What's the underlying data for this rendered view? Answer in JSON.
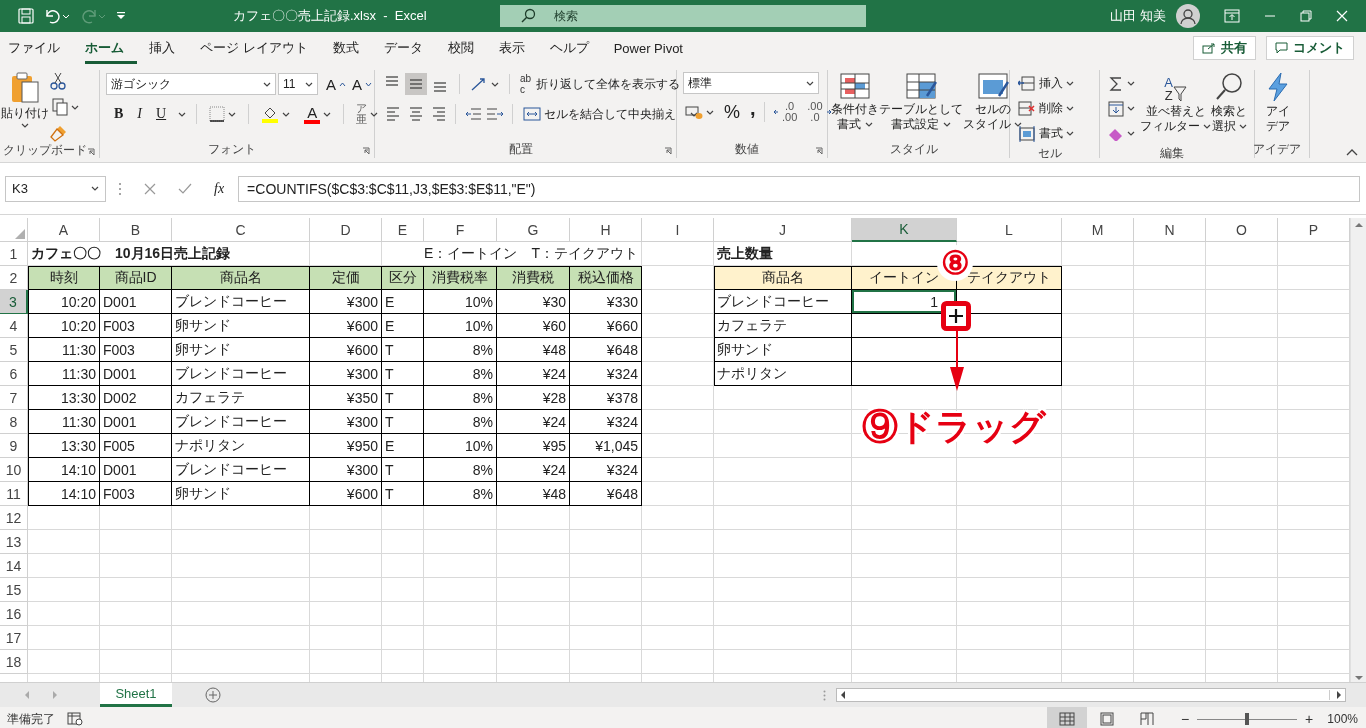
{
  "title_bar": {
    "file_title": "カフェ〇〇売上記録.xlsx  -  Excel",
    "search_placeholder": "検索",
    "user_name": "山田 知美",
    "redo_disabled": true
  },
  "menu_tabs": [
    {
      "label": "ファイル",
      "selected": false
    },
    {
      "label": "ホーム",
      "selected": true
    },
    {
      "label": "挿入",
      "selected": false
    },
    {
      "label": "ページ レイアウト",
      "selected": false
    },
    {
      "label": "数式",
      "selected": false
    },
    {
      "label": "データ",
      "selected": false
    },
    {
      "label": "校閲",
      "selected": false
    },
    {
      "label": "表示",
      "selected": false
    },
    {
      "label": "ヘルプ",
      "selected": false
    },
    {
      "label": "Power Pivot",
      "selected": false
    }
  ],
  "share_button": "共有",
  "comment_button": "コメント",
  "ribbon": {
    "groups": [
      {
        "kind": "clipboard",
        "label": "クリップボード",
        "paste": "貼り付け"
      },
      {
        "kind": "font",
        "label": "フォント",
        "font_name": "游ゴシック",
        "font_size": "11",
        "size_glyphs": [
          "A",
          "A"
        ],
        "style_glyphs": [
          "B",
          "I",
          "U"
        ],
        "color_glyph": "A",
        "phonetic_glyphs": [
          "ア",
          "亜"
        ]
      },
      {
        "kind": "alignment",
        "label": "配置",
        "align_buttons": [
          {
            "kind": "top",
            "selected": false
          },
          {
            "kind": "middle",
            "selected": true
          },
          {
            "kind": "bottom",
            "selected": false
          }
        ],
        "wrap_glyphs": [
          "ab",
          "c"
        ],
        "wrap_text": "折り返して全体を表示する",
        "merge": "セルを結合して中央揃え"
      },
      {
        "kind": "number",
        "label": "数値",
        "format": "標準",
        "percent": "%",
        "comma": ",",
        "decimal_glyphs": [
          ".0",
          ".00",
          ".00",
          ".0"
        ]
      },
      {
        "kind": "styles",
        "label": "スタイル",
        "buttons": [
          [
            "条件付き",
            "書式"
          ],
          [
            "テーブルとして",
            "書式設定"
          ],
          [
            "セルの",
            "スタイル"
          ]
        ]
      },
      {
        "kind": "cells",
        "label": "セル",
        "buttons": [
          "挿入",
          "削除",
          "書式"
        ]
      },
      {
        "kind": "editing",
        "label": "編集",
        "sort_glyphs": [
          "A",
          "Z"
        ],
        "buttons": [
          [
            "並べ替えと",
            "フィルター"
          ],
          [
            "検索と",
            "選択"
          ]
        ]
      },
      {
        "kind": "ideas",
        "label": "アイデア",
        "button": [
          "アイ",
          "デア"
        ]
      }
    ]
  },
  "formula_bar": {
    "name_box": "K3",
    "fx": "fx",
    "formula": "=COUNTIFS($C$3:$C$11,J3,$E$3:$E$11,\"E\")"
  },
  "sheet": {
    "columns": [
      {
        "label": "A",
        "selected": false
      },
      {
        "label": "B",
        "selected": false
      },
      {
        "label": "C",
        "selected": false
      },
      {
        "label": "D",
        "selected": false
      },
      {
        "label": "E",
        "selected": false
      },
      {
        "label": "F",
        "selected": false
      },
      {
        "label": "G",
        "selected": false
      },
      {
        "label": "H",
        "selected": false
      },
      {
        "label": "I",
        "selected": false
      },
      {
        "label": "J",
        "selected": false
      },
      {
        "label": "K",
        "selected": true
      },
      {
        "label": "L",
        "selected": false
      },
      {
        "label": "M",
        "selected": false
      },
      {
        "label": "N",
        "selected": false
      },
      {
        "label": "O",
        "selected": false
      },
      {
        "label": "P",
        "selected": false
      }
    ],
    "row_numbers": [
      {
        "label": "1",
        "selected": false
      },
      {
        "label": "2",
        "selected": false
      },
      {
        "label": "3",
        "selected": true
      },
      {
        "label": "4",
        "selected": false
      },
      {
        "label": "5",
        "selected": false
      },
      {
        "label": "6",
        "selected": false
      },
      {
        "label": "7",
        "selected": false
      },
      {
        "label": "8",
        "selected": false
      },
      {
        "label": "9",
        "selected": false
      },
      {
        "label": "10",
        "selected": false
      },
      {
        "label": "11",
        "selected": false
      },
      {
        "label": "12",
        "selected": false
      },
      {
        "label": "13",
        "selected": false
      },
      {
        "label": "14",
        "selected": false
      },
      {
        "label": "15",
        "selected": false
      },
      {
        "label": "16",
        "selected": false
      },
      {
        "label": "17",
        "selected": false
      },
      {
        "label": "18",
        "selected": false
      }
    ],
    "title": "カフェ〇〇　10月16日売上記録",
    "legend": "E：イートイン　T：テイクアウト",
    "summary_title": "売上数量",
    "sales_table": {
      "columns": [
        "時刻",
        "商品ID",
        "商品名",
        "定価",
        "区分",
        "消費税率",
        "消費税",
        "税込価格"
      ],
      "rows": [
        [
          "10:20",
          "D001",
          "ブレンドコーヒー",
          "¥300",
          "E",
          "10%",
          "¥30",
          "¥330"
        ],
        [
          "10:20",
          "F003",
          "卵サンド",
          "¥600",
          "E",
          "10%",
          "¥60",
          "¥660"
        ],
        [
          "11:30",
          "F003",
          "卵サンド",
          "¥600",
          "T",
          "8%",
          "¥48",
          "¥648"
        ],
        [
          "11:30",
          "D001",
          "ブレンドコーヒー",
          "¥300",
          "T",
          "8%",
          "¥24",
          "¥324"
        ],
        [
          "13:30",
          "D002",
          "カフェラテ",
          "¥350",
          "T",
          "8%",
          "¥28",
          "¥378"
        ],
        [
          "11:30",
          "D001",
          "ブレンドコーヒー",
          "¥300",
          "T",
          "8%",
          "¥24",
          "¥324"
        ],
        [
          "13:30",
          "F005",
          "ナポリタン",
          "¥950",
          "E",
          "10%",
          "¥95",
          "¥1,045"
        ],
        [
          "14:10",
          "D001",
          "ブレンドコーヒー",
          "¥300",
          "T",
          "8%",
          "¥24",
          "¥324"
        ],
        [
          "14:10",
          "F003",
          "卵サンド",
          "¥600",
          "T",
          "8%",
          "¥48",
          "¥648"
        ]
      ]
    },
    "quantity_table": {
      "columns": [
        "商品名",
        "イートイン",
        "テイクアウト"
      ],
      "rows": [
        {
          "product": "ブレンドコーヒー",
          "eat_in": "1"
        },
        {
          "product": "カフェラテ"
        },
        {
          "product": "卵サンド"
        },
        {
          "product": "ナポリタン"
        }
      ]
    }
  },
  "annotations": [
    {
      "kind": "badge",
      "text": "⑧"
    },
    {
      "kind": "caption",
      "text": "⑨ドラッグ"
    }
  ],
  "sheet_tabs": [
    {
      "label": "Sheet1",
      "selected": true
    }
  ],
  "status_bar": {
    "status": "準備完了",
    "views": [
      {
        "kind": "normal",
        "selected": true
      },
      {
        "kind": "page_layout",
        "selected": false
      },
      {
        "kind": "page_break",
        "selected": false
      }
    ],
    "zoom_out": "−",
    "zoom_slider": {
      "level": 0.5
    },
    "zoom_in": "+",
    "zoom": "100%"
  }
}
